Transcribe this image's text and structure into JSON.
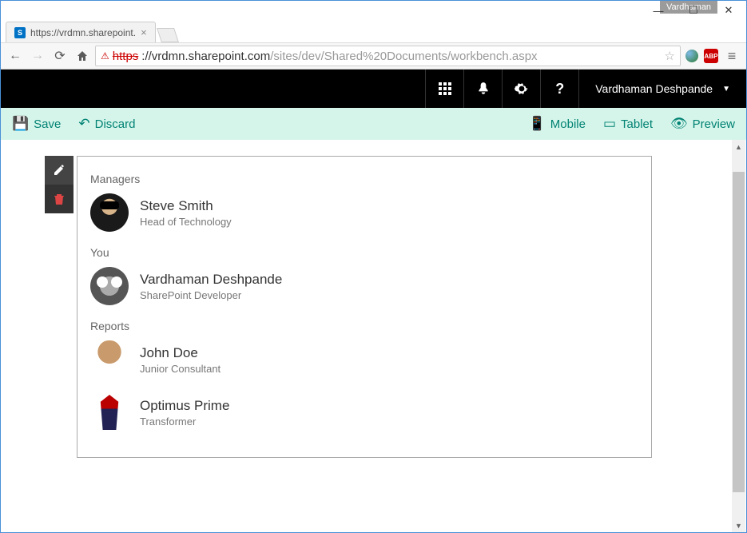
{
  "browser": {
    "profile_chip": "Vardhaman",
    "tab_title": "https://vrdmn.sharepoint.",
    "url_https": "https",
    "url_host": "://vrdmn.sharepoint.com",
    "url_path": "/sites/dev/Shared%20Documents/workbench.aspx",
    "abp": "ABP"
  },
  "sp_header": {
    "user_name": "Vardhaman Deshpande"
  },
  "cmdbar": {
    "save": "Save",
    "discard": "Discard",
    "mobile": "Mobile",
    "tablet": "Tablet",
    "preview": "Preview"
  },
  "webpart": {
    "sections": {
      "managers_label": "Managers",
      "you_label": "You",
      "reports_label": "Reports"
    },
    "managers": [
      {
        "name": "Steve Smith",
        "title": "Head of Technology"
      }
    ],
    "you": [
      {
        "name": "Vardhaman Deshpande",
        "title": "SharePoint Developer"
      }
    ],
    "reports": [
      {
        "name": "John Doe",
        "title": "Junior Consultant"
      },
      {
        "name": "Optimus Prime",
        "title": "Transformer"
      }
    ]
  }
}
